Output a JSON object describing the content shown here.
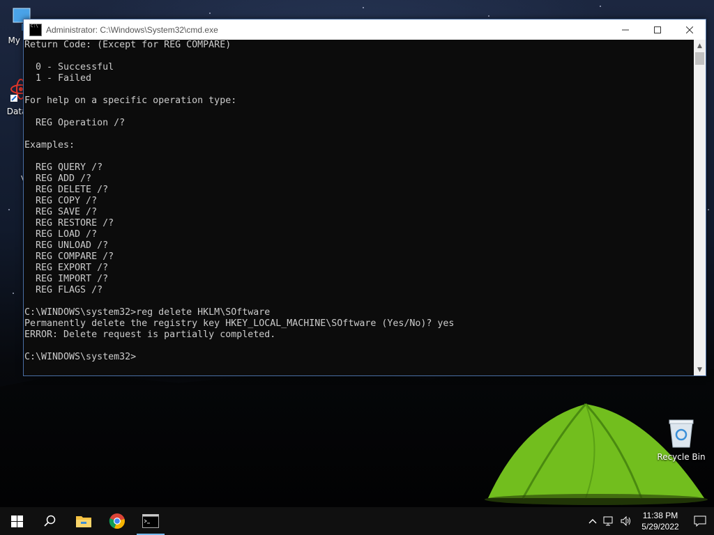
{
  "desktop": {
    "icons": [
      {
        "label": "My Co"
      },
      {
        "label": "DataW"
      },
      {
        "label": "V"
      },
      {
        "label": "Recycle Bin"
      }
    ]
  },
  "window": {
    "title": "Administrator: C:\\Windows\\System32\\cmd.exe",
    "minimize_icon": "minimize-icon",
    "maximize_icon": "maximize-icon",
    "close_icon": "close-icon"
  },
  "console": {
    "lines": [
      "Return Code: (Except for REG COMPARE)",
      "",
      "  0 - Successful",
      "  1 - Failed",
      "",
      "For help on a specific operation type:",
      "",
      "  REG Operation /?",
      "",
      "Examples:",
      "",
      "  REG QUERY /?",
      "  REG ADD /?",
      "  REG DELETE /?",
      "  REG COPY /?",
      "  REG SAVE /?",
      "  REG RESTORE /?",
      "  REG LOAD /?",
      "  REG UNLOAD /?",
      "  REG COMPARE /?",
      "  REG EXPORT /?",
      "  REG IMPORT /?",
      "  REG FLAGS /?",
      "",
      "C:\\WINDOWS\\system32>reg delete HKLM\\SOftware",
      "Permanently delete the registry key HKEY_LOCAL_MACHINE\\SOftware (Yes/No)? yes",
      "ERROR: Delete request is partially completed.",
      "",
      "C:\\WINDOWS\\system32>"
    ]
  },
  "taskbar": {
    "clock_time": "11:38 PM",
    "clock_date": "5/29/2022"
  },
  "colors": {
    "console_bg": "#0c0c0c",
    "console_fg": "#cccccc",
    "taskbar_bg": "#101010",
    "accent": "#76b9ed"
  }
}
